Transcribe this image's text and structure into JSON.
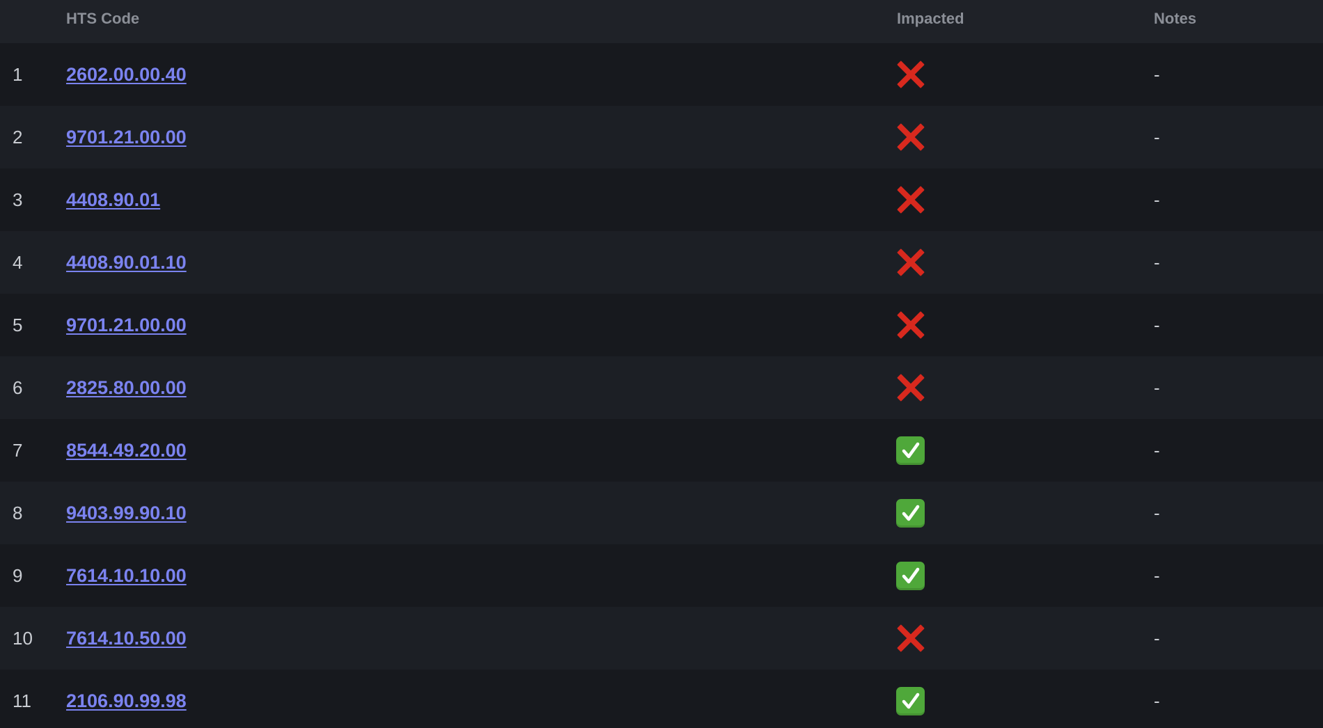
{
  "header": {
    "code_label": "HTS Code",
    "impacted_label": "Impacted",
    "notes_label": "Notes"
  },
  "rows": [
    {
      "num": "1",
      "code": "2602.00.00.40",
      "impacted": false,
      "notes": "-"
    },
    {
      "num": "2",
      "code": "9701.21.00.00",
      "impacted": false,
      "notes": "-"
    },
    {
      "num": "3",
      "code": "4408.90.01",
      "impacted": false,
      "notes": "-"
    },
    {
      "num": "4",
      "code": "4408.90.01.10",
      "impacted": false,
      "notes": "-"
    },
    {
      "num": "5",
      "code": "9701.21.00.00",
      "impacted": false,
      "notes": "-"
    },
    {
      "num": "6",
      "code": "2825.80.00.00",
      "impacted": false,
      "notes": "-"
    },
    {
      "num": "7",
      "code": "8544.49.20.00",
      "impacted": true,
      "notes": "-"
    },
    {
      "num": "8",
      "code": "9403.99.90.10",
      "impacted": true,
      "notes": "-"
    },
    {
      "num": "9",
      "code": "7614.10.10.00",
      "impacted": true,
      "notes": "-"
    },
    {
      "num": "10",
      "code": "7614.10.50.00",
      "impacted": false,
      "notes": "-"
    },
    {
      "num": "11",
      "code": "2106.90.99.98",
      "impacted": true,
      "notes": "-"
    }
  ],
  "icons": {
    "impacted_true": "check-mark-icon",
    "impacted_false": "cross-mark-icon"
  },
  "colors": {
    "link": "#7b83f0",
    "cross": "#d8291e",
    "check": "#4fa83a",
    "background": "#1b1e24"
  }
}
